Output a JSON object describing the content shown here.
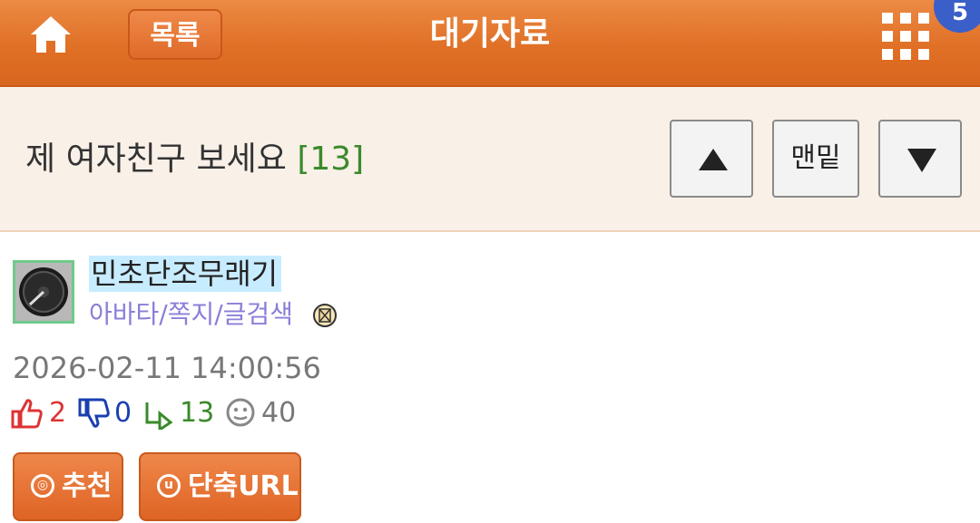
{
  "header": {
    "list_label": "목록",
    "title": "대기자료",
    "notification_count": "5",
    "home_icon": "home-icon",
    "menu_icon": "grid-menu-icon"
  },
  "post": {
    "title": "제 여자친구 보세요",
    "comment_count": "[13]",
    "nav": {
      "up_icon": "arrow-up-icon",
      "bottom_label": "맨밑",
      "down_icon": "arrow-down-icon"
    }
  },
  "author": {
    "name": "민초단조무래기",
    "links": "아바타/쪽지/글검색"
  },
  "meta": {
    "date": "2026-02-11 14:00:56",
    "likes": "2",
    "dislikes": "0",
    "replies": "13",
    "views": "40"
  },
  "actions": {
    "recommend_label": "추천",
    "short_url_label": "단축URL"
  },
  "colors": {
    "header_orange": "#e07026",
    "comment_count_green": "#3a8a2a",
    "link_purple": "#8a7fd8",
    "badge_blue": "#3a5fc8"
  }
}
